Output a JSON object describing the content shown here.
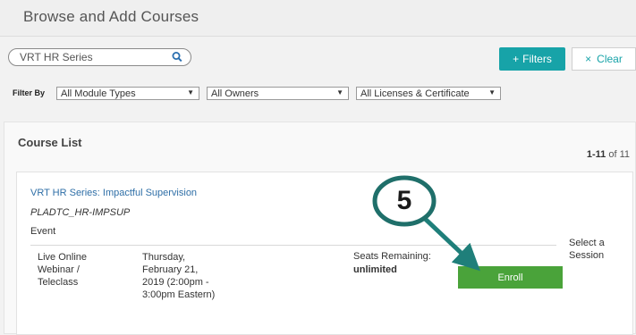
{
  "header": {
    "title": "Browse and Add Courses"
  },
  "search": {
    "value": "VRT HR Series",
    "icon": "search-icon"
  },
  "toolbar": {
    "filters_icon": "+",
    "filters_label": "Filters",
    "clear_icon": "×",
    "clear_label": "Clear"
  },
  "filters": {
    "label": "Filter By",
    "module_type": "All Module Types",
    "owner": "All Owners",
    "license": "All Licenses & Certificate"
  },
  "course_list": {
    "title": "Course List",
    "count_range": "1-11",
    "count_of": "of 11"
  },
  "course": {
    "title": "VRT HR Series: Impactful Supervision",
    "code": "PLADTC_HR-IMPSUP",
    "type": "Event",
    "delivery_line1": "Live Online",
    "delivery_line2": "Webinar /",
    "delivery_line3": "Teleclass",
    "date_line1": "Thursday,",
    "date_line2": "February 21,",
    "date_line3": "2019 (2:00pm -",
    "date_line4": "3:00pm Eastern)",
    "seats_label": "Seats Remaining:",
    "seats_value": "unlimited",
    "select_session_line1": "Select a",
    "select_session_line2": "Session",
    "enroll_label": "Enroll"
  },
  "callout": {
    "number": "5",
    "circle_color": "#1f6f6a",
    "arrow_color": "#1f7f7a"
  }
}
